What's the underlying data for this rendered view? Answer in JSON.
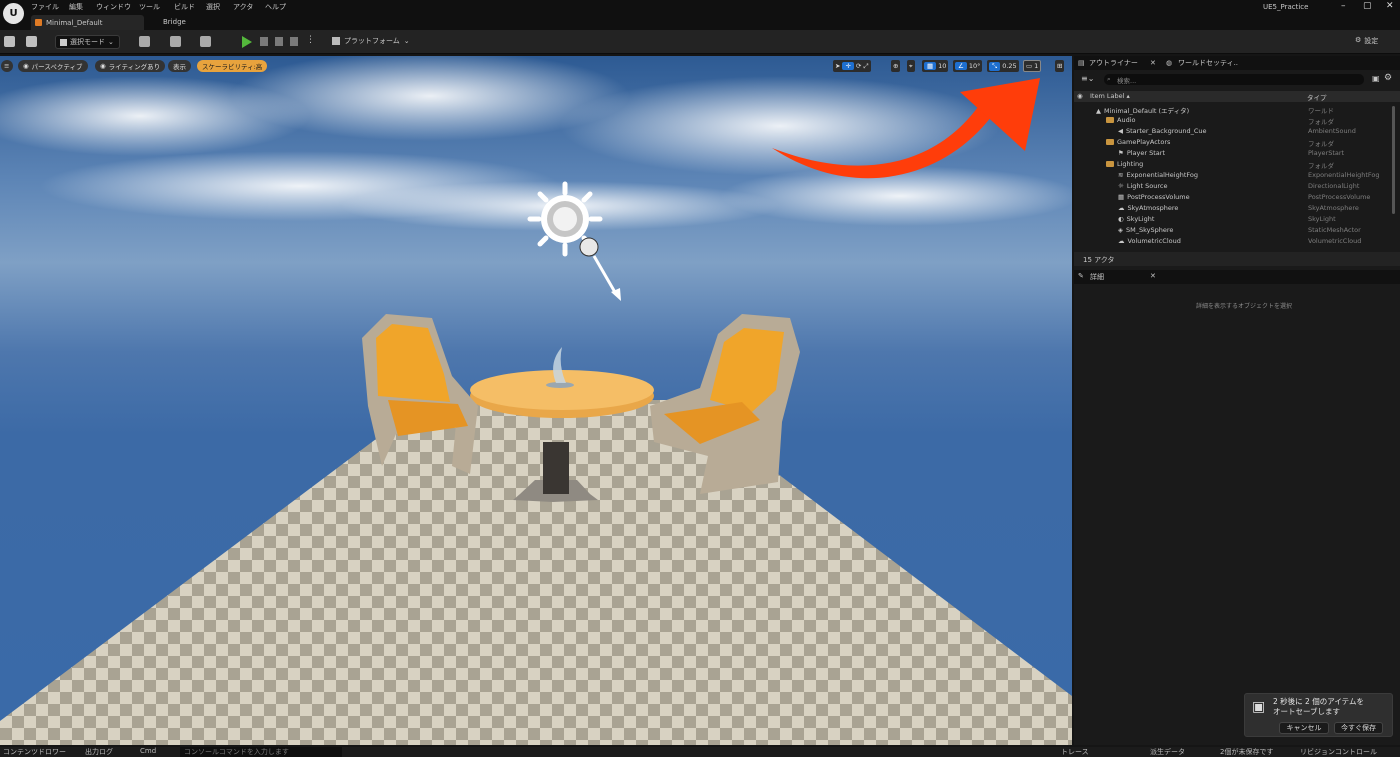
{
  "menu": {
    "items": [
      "ファイル",
      "編集",
      "ウィンドウ",
      "ツール",
      "ビルド",
      "選択",
      "アクタ",
      "ヘルプ"
    ]
  },
  "tabs": {
    "active": "Minimal_Default",
    "other": "Bridge"
  },
  "project_name": "UE5_Practice",
  "toolbar": {
    "mode_label": "選択モード",
    "platform_label": "プラットフォーム",
    "settings_label": "設定"
  },
  "viewport": {
    "perspective": "パースペクティブ",
    "lighting": "ライティングあり",
    "show": "表示",
    "scalability": "スケーラビリティ:高",
    "grid_snap": "10",
    "rotation_snap": "10°",
    "scale_snap": "0.25",
    "camera_speed": "1"
  },
  "outliner": {
    "tab_label": "アウトライナー",
    "world_tab_label": "ワールドセッティ..",
    "search_placeholder": "検索...",
    "col_label": "Item Label ▴",
    "col_type": "タイプ",
    "rows": [
      {
        "label": "Minimal_Default (エディタ)",
        "type": "ワールド",
        "indent": 22,
        "icon": "world"
      },
      {
        "label": "Audio",
        "type": "フォルダ",
        "indent": 32,
        "icon": "folder"
      },
      {
        "label": "Starter_Background_Cue",
        "type": "AmbientSound",
        "indent": 44,
        "icon": "speaker"
      },
      {
        "label": "GamePlayActors",
        "type": "フォルダ",
        "indent": 32,
        "icon": "folder"
      },
      {
        "label": "Player Start",
        "type": "PlayerStart",
        "indent": 44,
        "icon": "flag"
      },
      {
        "label": "Lighting",
        "type": "フォルダ",
        "indent": 32,
        "icon": "folder"
      },
      {
        "label": "ExponentialHeightFog",
        "type": "ExponentialHeightFog",
        "indent": 44,
        "icon": "fog"
      },
      {
        "label": "Light Source",
        "type": "DirectionalLight",
        "indent": 44,
        "icon": "light"
      },
      {
        "label": "PostProcessVolume",
        "type": "PostProcessVolume",
        "indent": 44,
        "icon": "volume"
      },
      {
        "label": "SkyAtmosphere",
        "type": "SkyAtmosphere",
        "indent": 44,
        "icon": "sky"
      },
      {
        "label": "SkyLight",
        "type": "SkyLight",
        "indent": 44,
        "icon": "skylight"
      },
      {
        "label": "SM_SkySphere",
        "type": "StaticMeshActor",
        "indent": 44,
        "icon": "mesh"
      },
      {
        "label": "VolumetricCloud",
        "type": "VolumetricCloud",
        "indent": 44,
        "icon": "cloud"
      }
    ],
    "actor_count": "15 アクタ"
  },
  "details": {
    "tab_label": "詳細",
    "empty_message": "詳細を表示するオブジェクトを選択"
  },
  "toast": {
    "message_line1": "2 秒後に 2 個のアイテムを",
    "message_line2": "オートセーブします",
    "cancel_label": "キャンセル",
    "save_now_label": "今すぐ保存"
  },
  "statusbar": {
    "content_drawer": "コンテンツドロワー",
    "output_log": "出力ログ",
    "cmd": "Cmd",
    "console_placeholder": "コンソールコマンドを入力します",
    "trace": "トレース",
    "derived_data": "派生データ",
    "unsaved": "2個が未保存です",
    "revision_control": "リビジョンコントロール"
  },
  "colors": {
    "accent_orange": "#e8a33d",
    "arrow_red": "#ff3d0a",
    "selection_blue": "#1e6fd0",
    "play_green": "#54b83c"
  }
}
